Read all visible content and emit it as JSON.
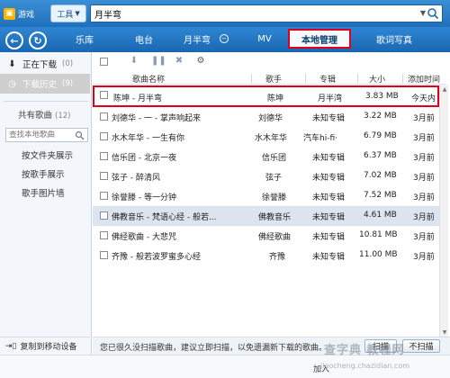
{
  "topbar": {
    "game_label": "游戏",
    "tool_label": "工具",
    "search_value": "月半弯",
    "game_icon": "game-icon",
    "search_icon": "search-icon"
  },
  "nav": {
    "tabs": [
      {
        "label": "乐库"
      },
      {
        "label": "电台"
      },
      {
        "label": "月半弯"
      },
      {
        "label": "MV"
      },
      {
        "label": "本地管理"
      },
      {
        "label": "歌词写真"
      }
    ],
    "active_tab": "本地管理",
    "back_icon": "back-arrow-icon",
    "refresh_icon": "refresh-icon"
  },
  "sidebar": {
    "downloading_label": "正在下载",
    "downloading_count": "(0)",
    "history_label": "下载历史",
    "history_count": "(9)",
    "shared_label": "共有歌曲",
    "shared_count": "(12)",
    "search_placeholder": "查找本地歌曲",
    "links": [
      "按文件夹展示",
      "按歌手展示",
      "歌手图片墙"
    ],
    "copy_device": "复制到移动设备"
  },
  "table": {
    "headers": {
      "name": "歌曲名称",
      "artist": "歌手",
      "album": "专辑",
      "size": "大小",
      "added": "添加时间"
    },
    "rows": [
      {
        "name": "陈坤 - 月半弯",
        "artist": "陈坤",
        "album": "月半湾",
        "size": "3.83 MB",
        "added": "今天内"
      },
      {
        "name": "刘德华 - 一 - 掌声响起来",
        "artist": "刘德华",
        "album": "未知专辑",
        "size": "3.22 MB",
        "added": "3月前"
      },
      {
        "name": "水木年华 - 一生有你",
        "artist": "水木年华",
        "album": "汽车hi-fi·",
        "size": "6.79 MB",
        "added": "3月前"
      },
      {
        "name": "信乐团 - 北京一夜",
        "artist": "信乐团",
        "album": "未知专辑",
        "size": "6.37 MB",
        "added": "3月前"
      },
      {
        "name": "弦子 - 醉清风",
        "artist": "弦子",
        "album": "未知专辑",
        "size": "7.02 MB",
        "added": "3月前"
      },
      {
        "name": "徐誉滕 - 等一分钟",
        "artist": "徐誉滕",
        "album": "未知专辑",
        "size": "7.52 MB",
        "added": "3月前"
      },
      {
        "name": "佛教音乐 - 梵语心经 - 般若...",
        "artist": "佛教音乐",
        "album": "未知专辑",
        "size": "4.61 MB",
        "added": "3月前"
      },
      {
        "name": "佛经歌曲 - 大悲咒",
        "artist": "佛经歌曲",
        "album": "未知专辑",
        "size": "10.81 MB",
        "added": "3月前"
      },
      {
        "name": "齐豫 - 般若波罗蜜多心经",
        "artist": "齐豫",
        "album": "未知专辑",
        "size": "11.00 MB",
        "added": "3月前"
      }
    ]
  },
  "status": {
    "message": "您已很久没扫描歌曲，建议立即扫描，以免遗漏新下载的歌曲。",
    "scan_label": "扫描",
    "no_scan_label": "不扫描"
  },
  "footer": {
    "join": "加入"
  },
  "watermark": {
    "main": "查字典 教程网",
    "sub": "jiaocheng.chazidian.com"
  },
  "colors": {
    "accent": "#1f6fba",
    "highlight_box": "#e0001b",
    "selected_row": "#dce5ef",
    "tab_underline": "#ffb400"
  }
}
